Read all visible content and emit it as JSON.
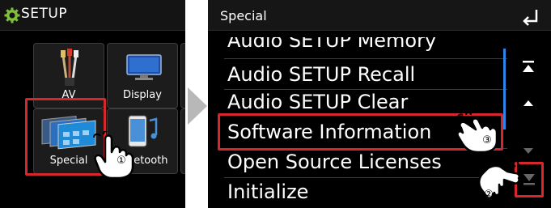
{
  "left": {
    "title": "SETUP",
    "tiles": [
      {
        "label": "AV"
      },
      {
        "label": "Display"
      },
      {
        "label": "Special"
      },
      {
        "label": "Bluetooth"
      }
    ],
    "step_marker": "①"
  },
  "right": {
    "title": "Special",
    "items": [
      {
        "label": "Audio SETUP Memory"
      },
      {
        "label": "Audio SETUP Recall"
      },
      {
        "label": "Audio SETUP Clear"
      },
      {
        "label": "Software Information"
      },
      {
        "label": "Open Source Licenses"
      },
      {
        "label": "Initialize"
      }
    ],
    "step_marker_bottom": "②",
    "step_marker_item": "③"
  },
  "icons": {
    "back": "back-arrow-icon",
    "top": "scroll-top-icon",
    "up": "scroll-up-icon",
    "down": "scroll-down-icon",
    "bottom": "scroll-bottom-icon"
  },
  "colors": {
    "highlight": "#d8262d",
    "scrollbar": "#2f84e6",
    "background": "#000000"
  }
}
